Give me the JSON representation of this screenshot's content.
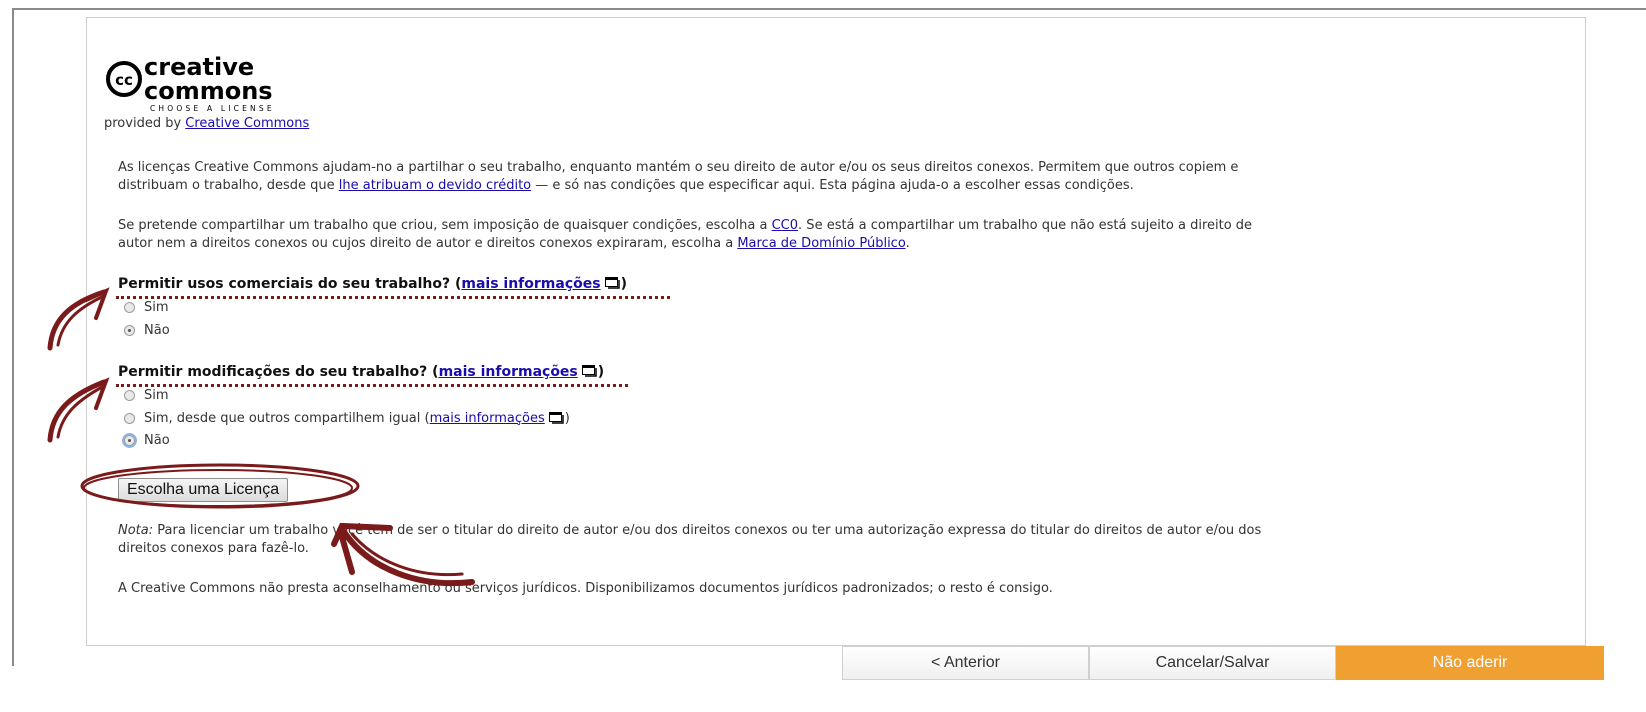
{
  "logo": {
    "brand_top": "creative",
    "brand_bottom": "commons",
    "tagline": "CHOOSE A LICENSE",
    "cc_mark": "cc",
    "icon": "creative-commons-logo"
  },
  "provided": {
    "prefix": "provided by ",
    "link": "Creative Commons"
  },
  "intro": {
    "line1": "As licenças Creative Commons ajudam-no a partilhar o seu trabalho, enquanto mantém o seu direito de autor e/ou os seus direitos conexos. Permitem que outros copiem e",
    "line2_pre": "distribuam o trabalho, desde que ",
    "line2_link": "lhe atribuam o devido crédito",
    "line2_post": " — e só nas condições que especificar aqui. Esta página ajuda-o a escolher essas condições."
  },
  "cc0": {
    "line1_pre": "Se pretende compartilhar um trabalho que criou, sem imposição de quaisquer condições, escolha a ",
    "line1_link": "CC0",
    "line1_post": ". Se está a compartilhar um trabalho que não está sujeito a direito de",
    "line2_pre": "autor nem a direitos conexos ou cujos direito de autor e direitos conexos expiraram, escolha a ",
    "line2_link": "Marca de Domínio Público",
    "line2_post": "."
  },
  "q1": {
    "label": "Permitir usos comerciais do seu trabalho? (",
    "link": "mais informações",
    "close": ")",
    "options": [
      "Sim",
      "Não"
    ],
    "selected": "Não"
  },
  "q2": {
    "label": "Permitir modificações do seu trabalho? (",
    "link": "mais informações",
    "close": ")",
    "options": [
      "Sim",
      "Sim, desde que outros compartilhem igual (",
      "Não"
    ],
    "option2_link": "mais informações",
    "option2_close": ")",
    "selected": "Não"
  },
  "choose_button": "Escolha uma Licença",
  "note": {
    "label": "Nota:",
    "line1": " Para licenciar um trabalho você tem de ser o titular do direito de autor e/ou dos direitos conexos ou ter uma autorização expressa do titular do direitos de autor e/ou dos",
    "line2": "direitos conexos para fazê-lo."
  },
  "disclaimer": "A Creative Commons não presta aconselhamento ou serviços jurídicos. Disponibilizamos documentos jurídicos padronizados; o resto é consigo.",
  "nav": {
    "prev": "< Anterior",
    "cancel": "Cancelar/Salvar",
    "decline": "Não aderir"
  },
  "colors": {
    "annotation": "#7a1a1a",
    "link": "#1a0dab",
    "accent_button": "#f0a030"
  }
}
